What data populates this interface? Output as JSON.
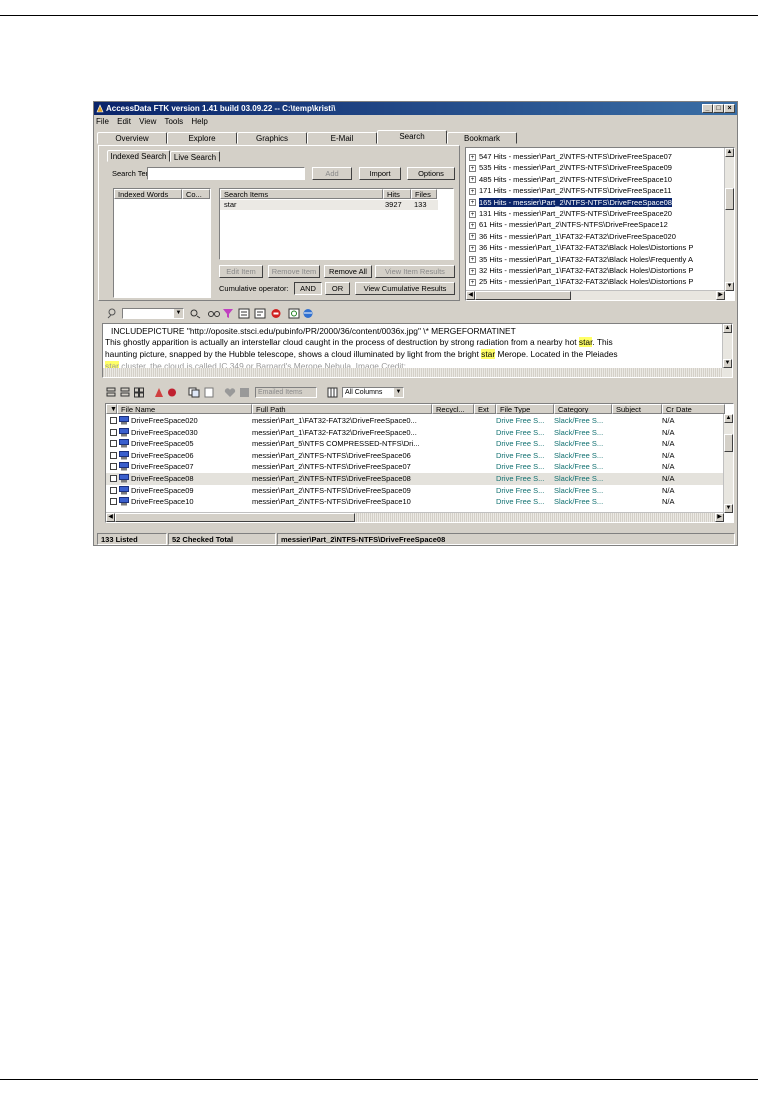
{
  "window": {
    "title": "AccessData FTK version 1.41 build 03.09.22 -- C:\\temp\\kristi\\",
    "controls": [
      "_",
      "□",
      "×"
    ]
  },
  "menu": [
    "File",
    "Edit",
    "View",
    "Tools",
    "Help"
  ],
  "tabs": [
    "Overview",
    "Explore",
    "Graphics",
    "E-Mail",
    "Search",
    "Bookmark"
  ],
  "active_tab": "Search",
  "search": {
    "subtabs": [
      "Indexed Search",
      "Live Search"
    ],
    "term_label": "Search Term:",
    "term_value": "",
    "add_label": "Add",
    "import_label": "Import",
    "options_label": "Options",
    "indexed_headers": [
      "Indexed Words",
      "Co..."
    ],
    "items_headers": [
      "Search Items",
      "Hits",
      "Files"
    ],
    "items": [
      {
        "term": "star",
        "hits": "3927",
        "files": "133"
      }
    ],
    "edit_item": "Edit Item",
    "remove_item": "Remove Item",
    "remove_all": "Remove All",
    "view_item_results": "View Item Results",
    "cumulative_label": "Cumulative operator:",
    "and_label": "AND",
    "or_label": "OR",
    "view_cumulative": "View Cumulative Results"
  },
  "hits_tree": [
    "547 Hits - messier\\Part_2\\NTFS-NTFS\\DriveFreeSpace07",
    "535 Hits - messier\\Part_2\\NTFS-NTFS\\DriveFreeSpace09",
    "485 Hits - messier\\Part_2\\NTFS-NTFS\\DriveFreeSpace10",
    "171 Hits - messier\\Part_2\\NTFS-NTFS\\DriveFreeSpace11",
    "165 Hits - messier\\Part_2\\NTFS-NTFS\\DriveFreeSpace08",
    "131 Hits - messier\\Part_2\\NTFS-NTFS\\DriveFreeSpace20",
    "61 Hits - messier\\Part_2\\NTFS-NTFS\\DriveFreeSpace12",
    "36 Hits - messier\\Part_1\\FAT32-FAT32\\DriveFreeSpace020",
    "36 Hits - messier\\Part_1\\FAT32-FAT32\\Black Holes\\Distortions P",
    "35 Hits - messier\\Part_1\\FAT32-FAT32\\Black Holes\\Frequently A",
    "32 Hits - messier\\Part_1\\FAT32-FAT32\\Black Holes\\Distortions P",
    "25 Hits - messier\\Part_1\\FAT32-FAT32\\Black Holes\\Distortions P"
  ],
  "selected_hit_index": 4,
  "preview": {
    "line1": " INCLUDEPICTURE \"http://oposite.stsci.edu/pubinfo/PR/2000/36/content/0036x.jpg\" \\* MERGEFORMATINET",
    "line2_a": "This ghostly apparition is actually an interstellar cloud caught in the process of destruction by strong radiation from a nearby hot ",
    "line2_hl": "star",
    "line2_b": ". This",
    "line3_a": "haunting picture, snapped by the Hubble telescope, shows a cloud illuminated by light from the bright ",
    "line3_hl": "star",
    "line3_b": " Merope. Located in the Pleiades",
    "line4_hl": "star",
    "line4_b": " cluster, the cloud is called IC 349 or Barnard's Merope Nebula. Image Credit:"
  },
  "file_toolbar": {
    "emailed_items": "Emailed Items",
    "columns": "All Columns"
  },
  "file_list": {
    "headers": [
      "File Name",
      "Full Path",
      "Recycl...",
      "Ext",
      "File Type",
      "Category",
      "Subject",
      "Cr Date"
    ],
    "rows": [
      {
        "name": "DriveFreeSpace020",
        "path": "messier\\Part_1\\FAT32-FAT32\\DriveFreeSpace0...",
        "type": "Drive Free S...",
        "category": "Slack/Free S...",
        "date": "N/A"
      },
      {
        "name": "DriveFreeSpace030",
        "path": "messier\\Part_1\\FAT32-FAT32\\DriveFreeSpace0...",
        "type": "Drive Free S...",
        "category": "Slack/Free S...",
        "date": "N/A"
      },
      {
        "name": "DriveFreeSpace05",
        "path": "messier\\Part_5\\NTFS COMPRESSED-NTFS\\Dri...",
        "type": "Drive Free S...",
        "category": "Slack/Free S...",
        "date": "N/A"
      },
      {
        "name": "DriveFreeSpace06",
        "path": "messier\\Part_2\\NTFS-NTFS\\DriveFreeSpace06",
        "type": "Drive Free S...",
        "category": "Slack/Free S...",
        "date": "N/A"
      },
      {
        "name": "DriveFreeSpace07",
        "path": "messier\\Part_2\\NTFS-NTFS\\DriveFreeSpace07",
        "type": "Drive Free S...",
        "category": "Slack/Free S...",
        "date": "N/A"
      },
      {
        "name": "DriveFreeSpace08",
        "path": "messier\\Part_2\\NTFS-NTFS\\DriveFreeSpace08",
        "type": "Drive Free S...",
        "category": "Slack/Free S...",
        "date": "N/A"
      },
      {
        "name": "DriveFreeSpace09",
        "path": "messier\\Part_2\\NTFS-NTFS\\DriveFreeSpace09",
        "type": "Drive Free S...",
        "category": "Slack/Free S...",
        "date": "N/A"
      },
      {
        "name": "DriveFreeSpace10",
        "path": "messier\\Part_2\\NTFS-NTFS\\DriveFreeSpace10",
        "type": "Drive Free S...",
        "category": "Slack/Free S...",
        "date": "N/A"
      }
    ],
    "selected_row": 5
  },
  "status_bar": {
    "listed": "133 Listed",
    "checked": "52 Checked Total",
    "path": "messier\\Part_2\\NTFS-NTFS\\DriveFreeSpace08"
  }
}
